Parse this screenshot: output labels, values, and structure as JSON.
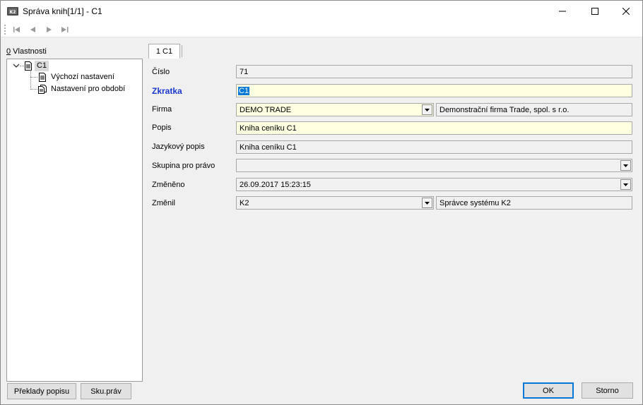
{
  "window": {
    "title": "Správa knih[1/1] - C1"
  },
  "toolbar": {
    "buttons": [
      "first-record-icon",
      "previous-record-icon",
      "next-record-icon",
      "last-record-icon"
    ]
  },
  "left_panel": {
    "label_prefix": "0",
    "label_rest": " Vlastnosti",
    "tree": {
      "root": "C1",
      "children": [
        "Výchozí nastavení",
        "Nastavení pro období"
      ]
    },
    "buttons": {
      "translations": "Překlady popisu",
      "rights_group": "Sku.práv"
    }
  },
  "tabs": [
    {
      "label": "1 C1"
    }
  ],
  "form": {
    "cislo": {
      "label": "Číslo",
      "value": "71"
    },
    "zkratka": {
      "label": "Zkratka",
      "value": "C1"
    },
    "firma": {
      "label": "Firma",
      "value": "DEMO TRADE",
      "description": "Demonstrační firma Trade, spol. s r.o."
    },
    "popis": {
      "label": "Popis",
      "value": "Kniha ceníku C1"
    },
    "jazykovy_popis": {
      "label": "Jazykový popis",
      "value": "Kniha ceníku C1"
    },
    "skupina": {
      "label": "Skupina pro právo",
      "value": ""
    },
    "zmeneno": {
      "label": "Změněno",
      "value": "26.09.2017 15:23:15"
    },
    "zmenil": {
      "label": "Změnil",
      "value": "K2",
      "description": "Správce systému K2"
    }
  },
  "footer": {
    "ok": "OK",
    "cancel": "Storno"
  },
  "colors": {
    "accent": "#0078d7",
    "required_label": "#1a38d0",
    "editable_field": "#ffffe1"
  }
}
